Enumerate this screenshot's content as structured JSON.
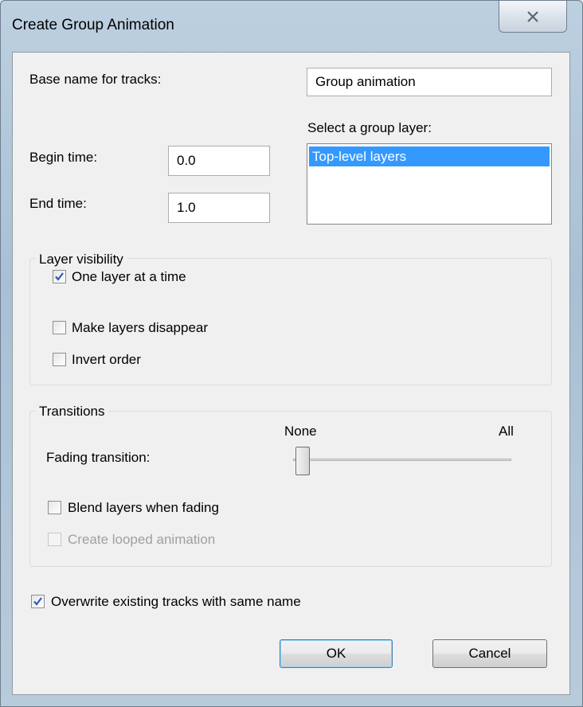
{
  "window": {
    "title": "Create Group Animation"
  },
  "form": {
    "base_name_label": "Base name for tracks:",
    "base_name_value": "Group animation",
    "select_group_label": "Select a group layer:",
    "group_layers": [
      "Top-level layers"
    ],
    "begin_time_label": "Begin time:",
    "begin_time_value": "0.0",
    "end_time_label": "End time:",
    "end_time_value": "1.0"
  },
  "layer_visibility": {
    "legend": "Layer visibility",
    "options": [
      {
        "label": "One layer at a time",
        "checked": true
      },
      {
        "label": "Make layers disappear",
        "checked": false
      },
      {
        "label": "Invert order",
        "checked": false
      }
    ]
  },
  "transitions": {
    "legend": "Transitions",
    "slider_min_label": "None",
    "slider_max_label": "All",
    "fading_label": "Fading transition:",
    "fading_value": 0,
    "blend_label": "Blend layers when fading",
    "blend_checked": false,
    "loop_label": "Create looped animation",
    "loop_checked": false,
    "loop_enabled": false
  },
  "overwrite": {
    "label": "Overwrite existing tracks with same name",
    "checked": true
  },
  "buttons": {
    "ok": "OK",
    "cancel": "Cancel"
  }
}
